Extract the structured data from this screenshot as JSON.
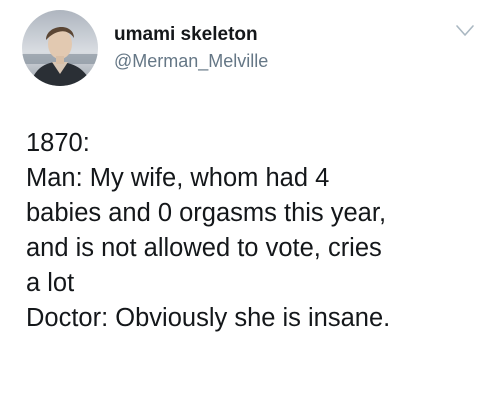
{
  "author": {
    "display_name": "umami skeleton",
    "handle": "@Merman_Melville"
  },
  "icons": {
    "menu": "chevron-down-icon"
  },
  "tweet": {
    "lines": [
      "1870:",
      "Man: My wife, whom had 4",
      "babies and 0 orgasms this year,",
      "and is not allowed to vote, cries",
      "a lot",
      "Doctor: Obviously she is insane."
    ]
  },
  "colors": {
    "text": "#14171a",
    "secondary": "#657786",
    "chevron": "#aab8c2"
  }
}
